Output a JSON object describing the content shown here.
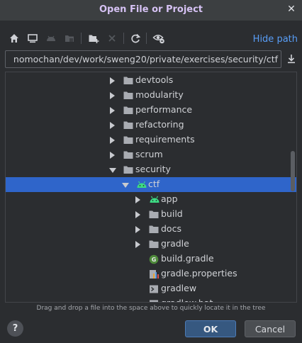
{
  "dialog": {
    "title": "Open File or Project",
    "close_symbol": "✕"
  },
  "toolbar": {
    "icons": [
      "home-icon",
      "desktop-icon",
      "android-project-icon",
      "project-folder-icon",
      "new-folder-icon",
      "delete-icon",
      "refresh-icon",
      "show-hidden-icon"
    ],
    "hide_path_label": "Hide path"
  },
  "path": {
    "value": "nomochan/dev/work/sweng20/private/exercises/security/ctf"
  },
  "tree": {
    "rows": [
      {
        "label": "devtools",
        "icon": "folder-icon",
        "expander": "collapsed"
      },
      {
        "label": "modularity",
        "icon": "folder-icon",
        "expander": "collapsed"
      },
      {
        "label": "performance",
        "icon": "folder-icon",
        "expander": "collapsed"
      },
      {
        "label": "refactoring",
        "icon": "folder-icon",
        "expander": "collapsed"
      },
      {
        "label": "requirements",
        "icon": "folder-icon",
        "expander": "collapsed"
      },
      {
        "label": "scrum",
        "icon": "folder-icon",
        "expander": "collapsed"
      },
      {
        "label": "security",
        "icon": "folder-icon",
        "expander": "expanded"
      },
      {
        "label": "ctf",
        "icon": "android-icon",
        "expander": "expanded",
        "selected": true
      },
      {
        "label": "app",
        "icon": "android-icon",
        "expander": "collapsed"
      },
      {
        "label": "build",
        "icon": "folder-icon",
        "expander": "collapsed"
      },
      {
        "label": "docs",
        "icon": "folder-icon",
        "expander": "collapsed"
      },
      {
        "label": "gradle",
        "icon": "folder-icon",
        "expander": "collapsed"
      },
      {
        "label": "build.gradle",
        "icon": "gradle-file-icon",
        "expander": "none"
      },
      {
        "label": "gradle.properties",
        "icon": "properties-file-icon",
        "expander": "none"
      },
      {
        "label": "gradlew",
        "icon": "shell-script-icon",
        "expander": "none"
      },
      {
        "label": "gradlew.bat",
        "icon": "batch-file-icon",
        "expander": "none"
      }
    ]
  },
  "hint": "Drag and drop a file into the space above to quickly locate it in the tree",
  "buttons": {
    "help": "?",
    "ok": "OK",
    "cancel": "Cancel"
  },
  "colors": {
    "selection": "#2f65ca",
    "link": "#589df6",
    "title": "#d6c2f4",
    "android_green": "#3ddc84",
    "primary_button": "#365880"
  }
}
